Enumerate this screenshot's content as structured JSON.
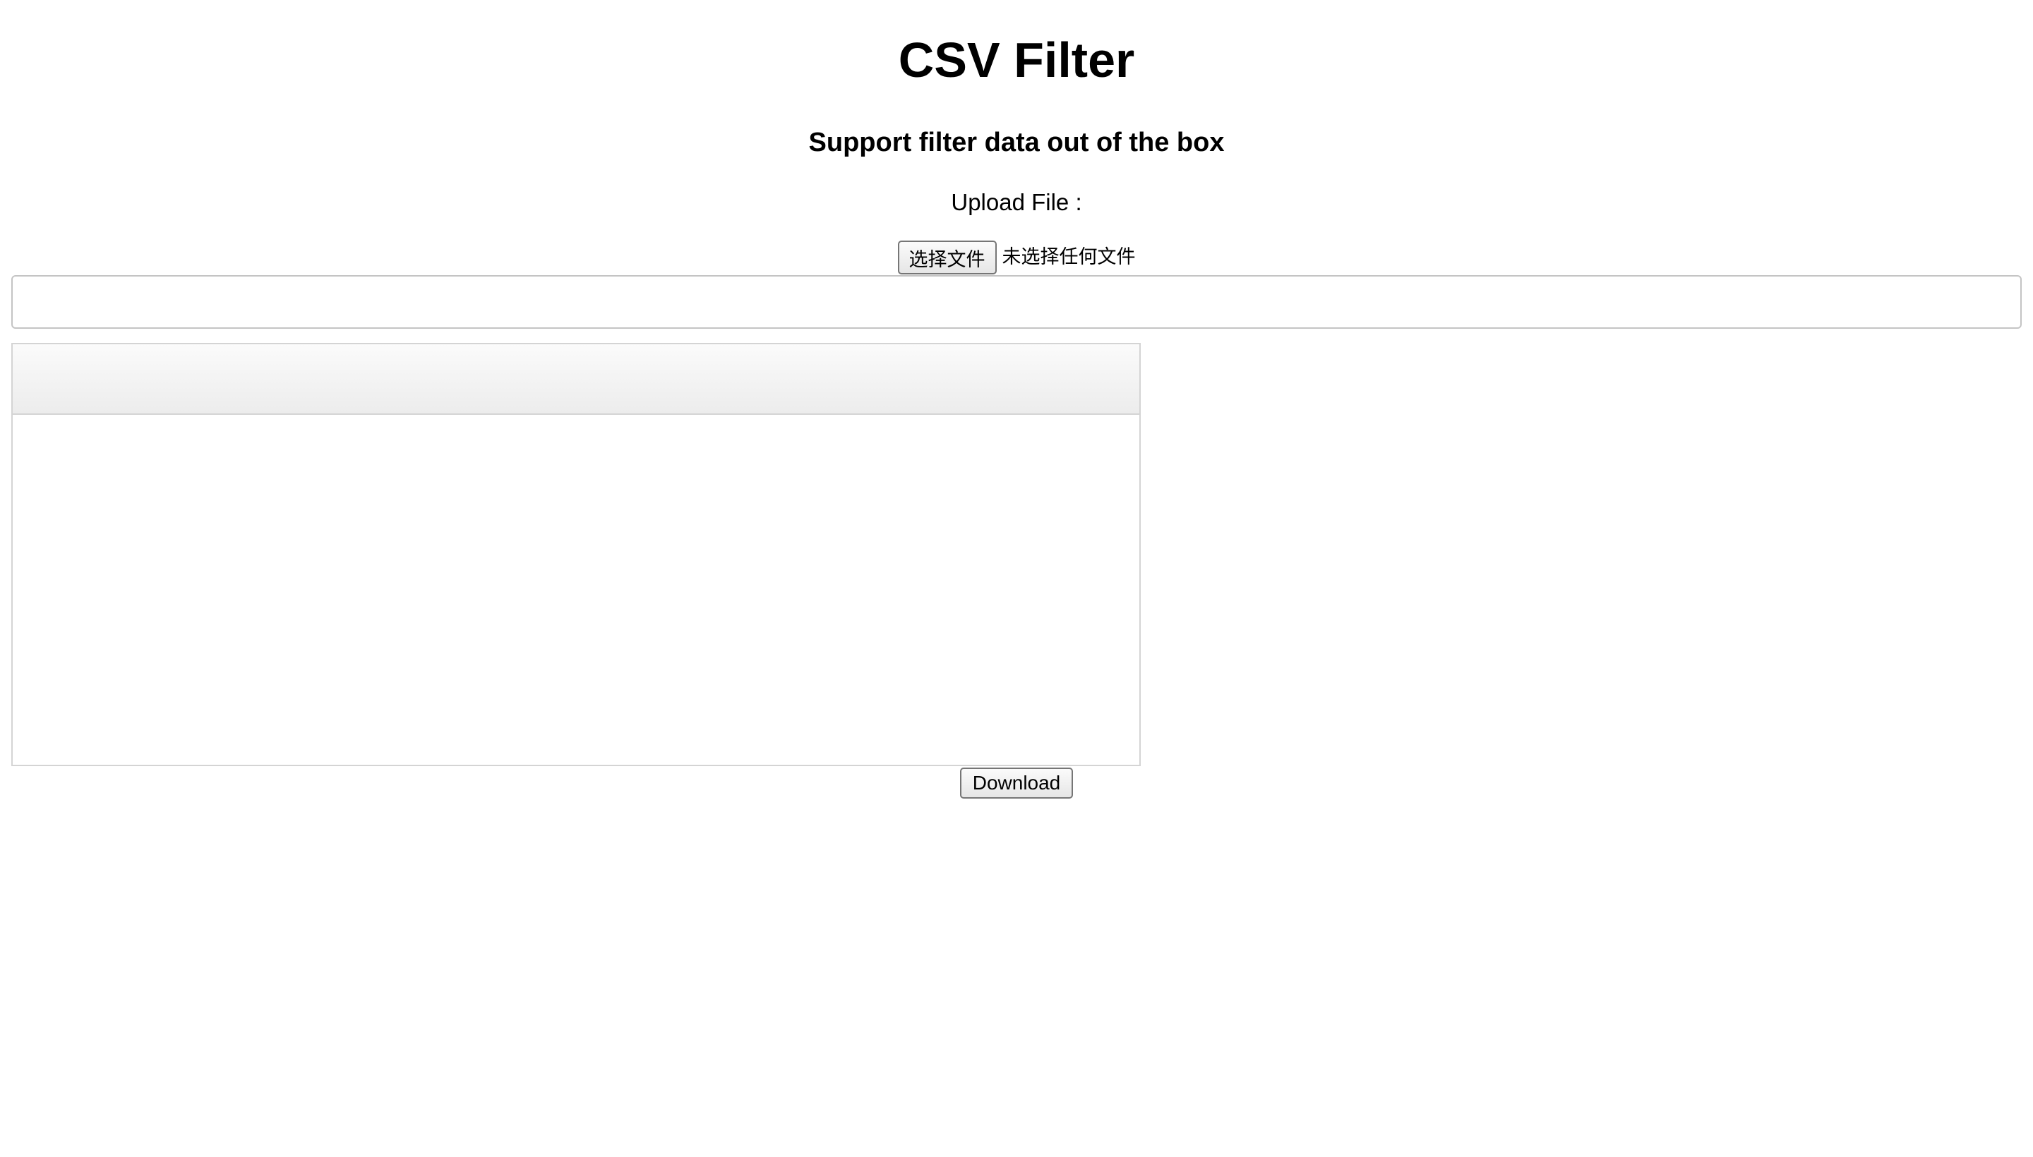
{
  "header": {
    "title": "CSV Filter",
    "subtitle": "Support filter data out of the box"
  },
  "upload": {
    "label": "Upload File :",
    "choose_button": "选择文件",
    "status": "未选择任何文件"
  },
  "filter": {
    "value": "",
    "placeholder": ""
  },
  "grid": {
    "columns": [],
    "rows": []
  },
  "actions": {
    "download_label": "Download"
  }
}
